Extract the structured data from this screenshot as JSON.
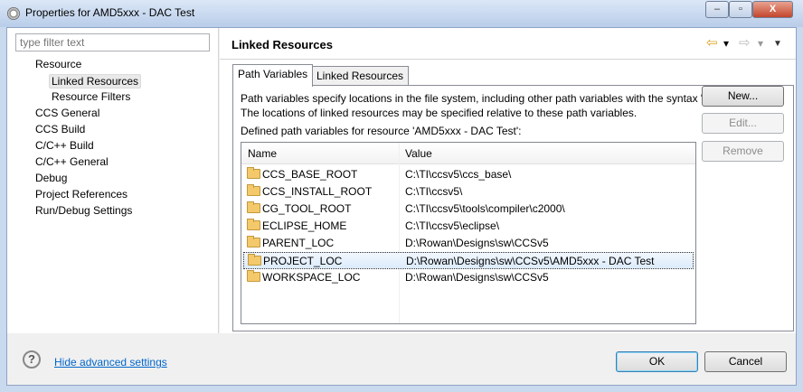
{
  "window": {
    "title": "Properties for AMD5xxx - DAC Test",
    "minimize": "–",
    "maximize": "▫",
    "close": "X"
  },
  "sidebar": {
    "filter_placeholder": "type filter text",
    "items": [
      {
        "label": "Resource",
        "level": 0
      },
      {
        "label": "Linked Resources",
        "level": 1,
        "selected": true
      },
      {
        "label": "Resource Filters",
        "level": 1
      },
      {
        "label": "CCS General",
        "level": 0
      },
      {
        "label": "CCS Build",
        "level": 0
      },
      {
        "label": "C/C++ Build",
        "level": 0
      },
      {
        "label": "C/C++ General",
        "level": 0
      },
      {
        "label": "Debug",
        "level": 0
      },
      {
        "label": "Project References",
        "level": 0
      },
      {
        "label": "Run/Debug Settings",
        "level": 0
      }
    ]
  },
  "main": {
    "title": "Linked Resources",
    "nav": {
      "back": "⇦",
      "back_menu": "▾",
      "forward": "⇨",
      "forward_menu": "▾",
      "view_menu": "▼"
    },
    "tabs": [
      {
        "label": "Path Variables",
        "active": true
      },
      {
        "label": "Linked Resources"
      }
    ],
    "description": [
      "Path variables specify locations in the file system, including other path variables with the syntax \"${VAR}\".",
      "The locations of linked resources may be specified relative to these path variables."
    ],
    "defined_label": "Defined path variables for resource 'AMD5xxx - DAC Test':",
    "table": {
      "columns": [
        "Name",
        "Value"
      ],
      "rows": [
        {
          "name": "CCS_BASE_ROOT",
          "value": "C:\\TI\\ccsv5\\ccs_base\\"
        },
        {
          "name": "CCS_INSTALL_ROOT",
          "value": "C:\\TI\\ccsv5\\"
        },
        {
          "name": "CG_TOOL_ROOT",
          "value": "C:\\TI\\ccsv5\\tools\\compiler\\c2000\\"
        },
        {
          "name": "ECLIPSE_HOME",
          "value": "C:\\TI\\ccsv5\\eclipse\\"
        },
        {
          "name": "PARENT_LOC",
          "value": "D:\\Rowan\\Designs\\sw\\CCSv5"
        },
        {
          "name": "PROJECT_LOC",
          "value": "D:\\Rowan\\Designs\\sw\\CCSv5\\AMD5xxx - DAC Test",
          "selected": true
        },
        {
          "name": "WORKSPACE_LOC",
          "value": "D:\\Rowan\\Designs\\sw\\CCSv5"
        }
      ]
    },
    "buttons": {
      "new": "New...",
      "edit": "Edit...",
      "remove": "Remove"
    }
  },
  "footer": {
    "help": "?",
    "hide_advanced": "Hide advanced settings",
    "ok": "OK",
    "cancel": "Cancel"
  }
}
